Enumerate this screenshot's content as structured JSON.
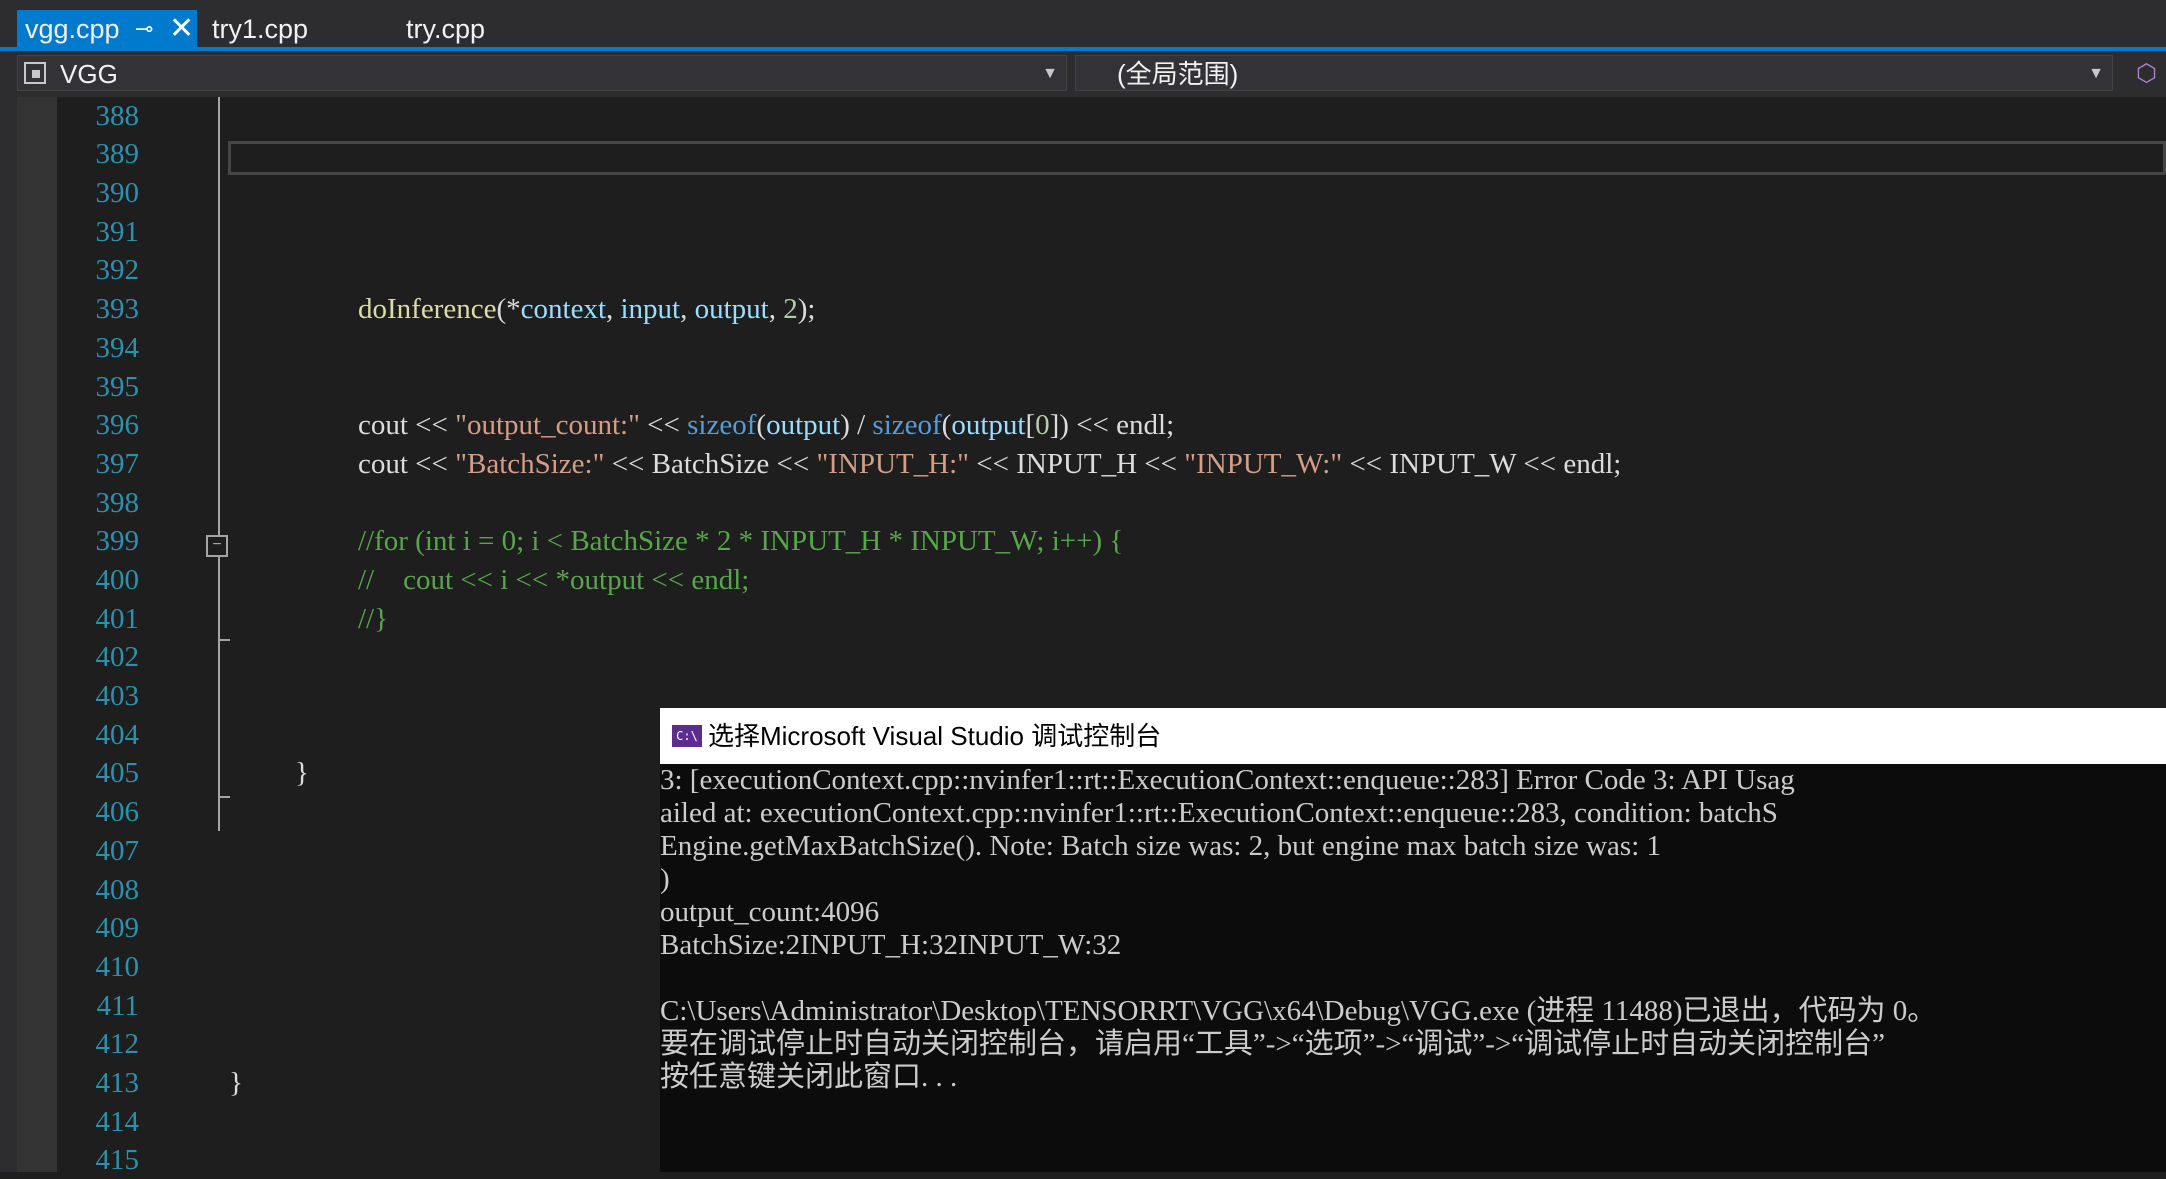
{
  "tabs": [
    {
      "label": "vgg.cpp",
      "active": true
    },
    {
      "label": "try1.cpp",
      "active": false
    },
    {
      "label": "try.cpp",
      "active": false
    }
  ],
  "icons": {
    "pin": "pin-icon",
    "close": "close-icon",
    "class": "class-icon",
    "dropdown": "chevron-down-icon",
    "split": "split-editor-icon",
    "console": "console-app-icon"
  },
  "navbar": {
    "class_combo": "VGG",
    "scope_combo": "(全局范围)"
  },
  "colors": {
    "accent": "#007acc",
    "line_number": "#2b91af",
    "function": "#dcdcaa",
    "variable": "#9cdcfe",
    "string": "#d69d85",
    "keyword": "#569cd6",
    "comment": "#57a64a",
    "console_icon": "#5c2d91"
  },
  "editor": {
    "line_numbers": [
      "388",
      "389",
      "390",
      "391",
      "392",
      "393",
      "394",
      "395",
      "396",
      "397",
      "398",
      "399",
      "400",
      "401",
      "402",
      "403",
      "404",
      "405",
      "406",
      "407",
      "408",
      "409",
      "410",
      "411",
      "412",
      "413",
      "414",
      "415"
    ],
    "code": {
      "l393": {
        "fn": "doInference",
        "p1": "(*",
        "context": "context",
        "p2": ", ",
        "input": "input",
        "p3": ", ",
        "output": "output",
        "p4": ", ",
        "num": "2",
        "p5": ");"
      },
      "l396": {
        "a": "cout << ",
        "s1": "\"output_count:\"",
        "b": " << ",
        "kw1": "sizeof",
        "c": "(",
        "v1": "output",
        "d": ") / ",
        "kw2": "sizeof",
        "e": "(",
        "v2": "output",
        "f": "[",
        "num": "0",
        "g": "]) << endl;"
      },
      "l397": {
        "a": "cout << ",
        "s1": "\"BatchSize:\"",
        "b": " << BatchSize << ",
        "s2": "\"INPUT_H:\"",
        "c": " << INPUT_H << ",
        "s3": "\"INPUT_W:\"",
        "d": " << INPUT_W << endl;"
      },
      "l399": "//for (int i = 0; i < BatchSize * 2 * INPUT_H * INPUT_W; i++) {",
      "l400": "//    cout << i << *output << endl;",
      "l401": "//}",
      "l405": "}",
      "l413": "}"
    }
  },
  "console": {
    "title": "选择Microsoft Visual Studio 调试控制台",
    "lines": [
      "3: [executionContext.cpp::nvinfer1::rt::ExecutionContext::enqueue::283] Error Code 3: API Usag",
      "ailed at: executionContext.cpp::nvinfer1::rt::ExecutionContext::enqueue::283, condition: batchS",
      "Engine.getMaxBatchSize(). Note: Batch size was: 2, but engine max batch size was: 1",
      ")",
      "output_count:4096",
      "BatchSize:2INPUT_H:32INPUT_W:32",
      "",
      "C:\\Users\\Administrator\\Desktop\\TENSORRT\\VGG\\x64\\Debug\\VGG.exe (进程 11488)已退出，代码为 0。",
      "要在调试停止时自动关闭控制台，请启用“工具”->“选项”->“调试”->“调试停止时自动关闭控制台”",
      "按任意键关闭此窗口. . ."
    ]
  }
}
